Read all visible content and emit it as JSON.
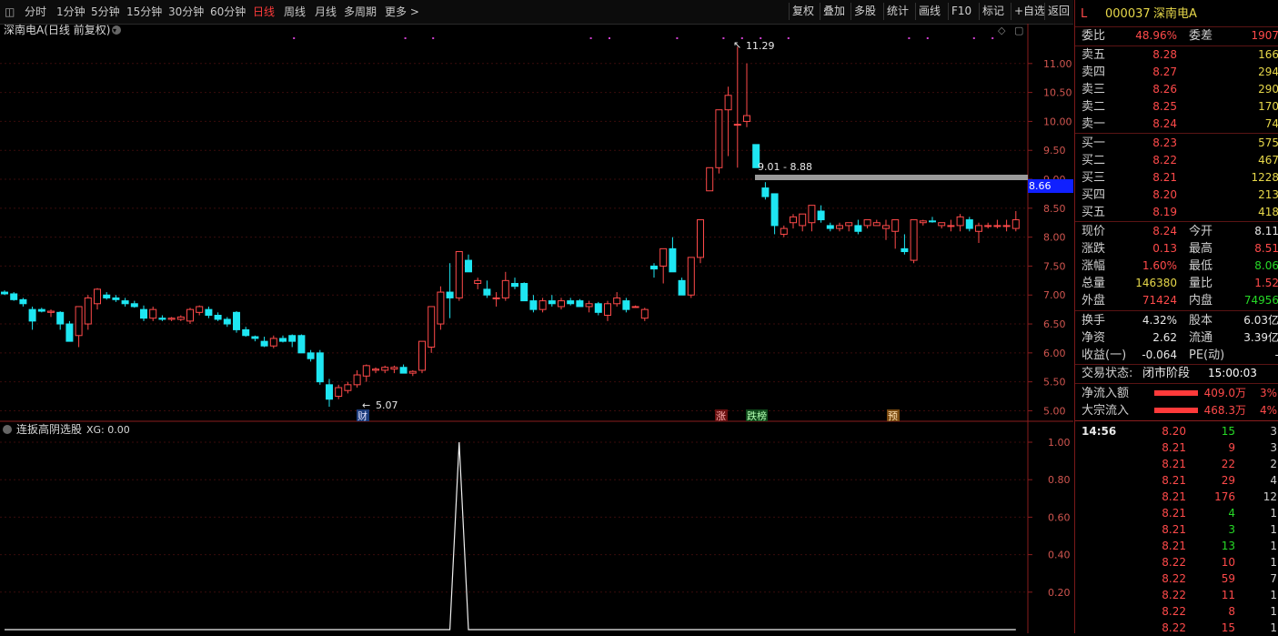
{
  "toolbar": {
    "periods": [
      "分时",
      "1分钟",
      "5分钟",
      "15分钟",
      "30分钟",
      "60分钟",
      "日线",
      "周线",
      "月线",
      "多周期",
      "更多 >"
    ],
    "active_period": "日线",
    "actions": [
      "复权",
      "叠加",
      "多股",
      "统计",
      "画线",
      "F10",
      "标记",
      "+自选",
      "返回"
    ]
  },
  "main_chart": {
    "title": "深南电A(日线 前复权)",
    "y_ticks": [
      "11.00",
      "10.50",
      "10.00",
      "9.50",
      "9.00",
      "8.50",
      "8.00",
      "7.50",
      "7.00",
      "6.50",
      "6.00",
      "5.50",
      "5.00"
    ],
    "high_label": "11.29",
    "low_label": "5.07",
    "range_label": "9.01 - 8.88",
    "current_price_tag": "8.66",
    "event_markers": [
      "财",
      "涨",
      "跌榜",
      "预"
    ]
  },
  "indicator": {
    "title": "连扳高阴选股",
    "value_label": "XG: 0.00",
    "y_ticks": [
      "1.00",
      "0.80",
      "0.60",
      "0.40",
      "0.20"
    ]
  },
  "chart_data": {
    "type": "candlestick",
    "ylim": [
      4.85,
      11.5
    ],
    "candles": [
      [
        7.05,
        7.08,
        7.0,
        7.02
      ],
      [
        7.02,
        7.05,
        6.9,
        6.92
      ],
      [
        6.92,
        6.95,
        6.8,
        6.85
      ],
      [
        6.75,
        6.8,
        6.4,
        6.55
      ],
      [
        6.75,
        6.78,
        6.7,
        6.72
      ],
      [
        6.7,
        6.75,
        6.62,
        6.72
      ],
      [
        6.7,
        6.72,
        6.4,
        6.5
      ],
      [
        6.5,
        6.55,
        6.2,
        6.2
      ],
      [
        6.3,
        6.8,
        6.1,
        6.8
      ],
      [
        6.5,
        7.0,
        6.4,
        6.95
      ],
      [
        6.85,
        7.12,
        6.75,
        7.1
      ],
      [
        7.0,
        7.05,
        6.92,
        6.95
      ],
      [
        6.95,
        7.0,
        6.88,
        6.92
      ],
      [
        6.9,
        6.95,
        6.8,
        6.85
      ],
      [
        6.85,
        6.9,
        6.78,
        6.8
      ],
      [
        6.75,
        6.82,
        6.55,
        6.6
      ],
      [
        6.6,
        6.8,
        6.55,
        6.75
      ],
      [
        6.6,
        6.65,
        6.55,
        6.58
      ],
      [
        6.58,
        6.62,
        6.55,
        6.6
      ],
      [
        6.58,
        6.65,
        6.55,
        6.62
      ],
      [
        6.55,
        6.78,
        6.5,
        6.75
      ],
      [
        6.7,
        6.82,
        6.65,
        6.8
      ],
      [
        6.75,
        6.8,
        6.6,
        6.65
      ],
      [
        6.65,
        6.7,
        6.55,
        6.58
      ],
      [
        6.58,
        6.62,
        6.45,
        6.5
      ],
      [
        6.7,
        6.72,
        6.35,
        6.4
      ],
      [
        6.4,
        6.45,
        6.28,
        6.3
      ],
      [
        6.28,
        6.3,
        6.2,
        6.25
      ],
      [
        6.2,
        6.28,
        6.1,
        6.12
      ],
      [
        6.12,
        6.3,
        6.08,
        6.25
      ],
      [
        6.25,
        6.3,
        6.18,
        6.2
      ],
      [
        6.3,
        6.32,
        6.1,
        6.2
      ],
      [
        6.3,
        6.32,
        6.0,
        6.0
      ],
      [
        6.0,
        6.05,
        5.85,
        5.9
      ],
      [
        6.0,
        6.05,
        5.45,
        5.5
      ],
      [
        5.45,
        5.55,
        5.07,
        5.2
      ],
      [
        5.25,
        5.45,
        5.2,
        5.4
      ],
      [
        5.35,
        5.5,
        5.3,
        5.45
      ],
      [
        5.45,
        5.7,
        5.4,
        5.62
      ],
      [
        5.6,
        5.8,
        5.5,
        5.78
      ],
      [
        5.7,
        5.75,
        5.65,
        5.72
      ],
      [
        5.7,
        5.78,
        5.65,
        5.75
      ],
      [
        5.72,
        5.78,
        5.65,
        5.75
      ],
      [
        5.75,
        5.8,
        5.65,
        5.65
      ],
      [
        5.65,
        5.7,
        5.6,
        5.68
      ],
      [
        5.7,
        6.2,
        5.65,
        6.2
      ],
      [
        6.1,
        6.8,
        6.0,
        6.8
      ],
      [
        6.5,
        7.15,
        6.4,
        7.05
      ],
      [
        7.05,
        7.55,
        6.6,
        6.95
      ],
      [
        6.95,
        7.75,
        6.9,
        7.75
      ],
      [
        7.6,
        7.7,
        7.4,
        7.4
      ],
      [
        7.2,
        7.3,
        7.1,
        7.25
      ],
      [
        7.1,
        7.25,
        6.95,
        7.0
      ],
      [
        6.95,
        7.05,
        6.8,
        6.95
      ],
      [
        6.95,
        7.4,
        6.9,
        7.25
      ],
      [
        7.2,
        7.3,
        7.1,
        7.15
      ],
      [
        7.2,
        7.22,
        6.9,
        6.9
      ],
      [
        6.9,
        7.0,
        6.7,
        6.75
      ],
      [
        6.75,
        6.95,
        6.7,
        6.9
      ],
      [
        6.9,
        7.0,
        6.8,
        6.85
      ],
      [
        6.8,
        6.95,
        6.75,
        6.9
      ],
      [
        6.9,
        6.95,
        6.82,
        6.85
      ],
      [
        6.9,
        6.93,
        6.8,
        6.8
      ],
      [
        6.8,
        6.9,
        6.7,
        6.85
      ],
      [
        6.85,
        6.88,
        6.65,
        6.7
      ],
      [
        6.65,
        6.9,
        6.55,
        6.85
      ],
      [
        6.85,
        7.05,
        6.8,
        6.95
      ],
      [
        6.9,
        6.95,
        6.7,
        6.75
      ],
      [
        6.8,
        6.82,
        6.78,
        6.8
      ],
      [
        6.6,
        6.78,
        6.55,
        6.75
      ],
      [
        7.5,
        7.55,
        7.3,
        7.45
      ],
      [
        7.5,
        7.7,
        7.2,
        7.8
      ],
      [
        7.8,
        8.0,
        7.4,
        7.4
      ],
      [
        7.25,
        7.3,
        7.0,
        7.0
      ],
      [
        7.0,
        7.65,
        6.95,
        7.65
      ],
      [
        7.65,
        8.2,
        7.55,
        8.3
      ],
      [
        8.8,
        9.1,
        8.8,
        9.2
      ],
      [
        9.2,
        10.2,
        9.1,
        10.2
      ],
      [
        10.2,
        10.6,
        9.4,
        10.45
      ],
      [
        9.95,
        11.29,
        9.2,
        9.95
      ],
      [
        10.0,
        11.0,
        9.9,
        10.1
      ],
      [
        9.6,
        9.6,
        9.2,
        9.2
      ],
      [
        8.85,
        8.95,
        8.65,
        8.7
      ],
      [
        8.75,
        8.75,
        8.05,
        8.2
      ],
      [
        8.05,
        8.2,
        8.0,
        8.15
      ],
      [
        8.25,
        8.4,
        8.15,
        8.35
      ],
      [
        8.2,
        8.4,
        8.1,
        8.4
      ],
      [
        8.25,
        8.55,
        8.1,
        8.55
      ],
      [
        8.45,
        8.55,
        8.25,
        8.3
      ],
      [
        8.2,
        8.25,
        8.1,
        8.15
      ],
      [
        8.15,
        8.25,
        8.1,
        8.2
      ],
      [
        8.2,
        8.25,
        8.1,
        8.25
      ],
      [
        8.2,
        8.3,
        8.05,
        8.1
      ],
      [
        8.2,
        8.3,
        8.15,
        8.3
      ],
      [
        8.2,
        8.3,
        8.2,
        8.25
      ],
      [
        8.15,
        8.3,
        7.95,
        8.2
      ],
      [
        8.1,
        8.3,
        7.8,
        8.3
      ],
      [
        7.8,
        8.05,
        7.7,
        7.75
      ],
      [
        7.6,
        8.3,
        7.55,
        8.3
      ],
      [
        8.25,
        8.3,
        8.2,
        8.28
      ],
      [
        8.28,
        8.35,
        8.25,
        8.27
      ],
      [
        8.2,
        8.25,
        8.15,
        8.25
      ],
      [
        8.2,
        8.3,
        8.1,
        8.2
      ],
      [
        8.2,
        8.4,
        8.1,
        8.35
      ],
      [
        8.3,
        8.35,
        8.1,
        8.15
      ],
      [
        8.1,
        8.25,
        7.9,
        8.2
      ],
      [
        8.2,
        8.25,
        8.15,
        8.2
      ],
      [
        8.2,
        8.3,
        8.15,
        8.2
      ],
      [
        8.2,
        8.3,
        8.1,
        8.2
      ],
      [
        8.15,
        8.45,
        8.1,
        8.3
      ]
    ],
    "indicator_series": {
      "name": "XG",
      "signal_index": 49,
      "values_default": 0,
      "signal_value": 1
    }
  },
  "panel": {
    "code": "000037",
    "name": "深南电A",
    "flag": "L",
    "weibi_label": "委比",
    "weibi": "48.96%",
    "weicha_label": "委差",
    "weicha": "1907",
    "sells": [
      {
        "label": "卖五",
        "price": "8.28",
        "vol": "166"
      },
      {
        "label": "卖四",
        "price": "8.27",
        "vol": "294"
      },
      {
        "label": "卖三",
        "price": "8.26",
        "vol": "290"
      },
      {
        "label": "卖二",
        "price": "8.25",
        "vol": "170"
      },
      {
        "label": "卖一",
        "price": "8.24",
        "vol": "74"
      }
    ],
    "buys": [
      {
        "label": "买一",
        "price": "8.23",
        "vol": "575"
      },
      {
        "label": "买二",
        "price": "8.22",
        "vol": "467"
      },
      {
        "label": "买三",
        "price": "8.21",
        "vol": "1228"
      },
      {
        "label": "买四",
        "price": "8.20",
        "vol": "213"
      },
      {
        "label": "买五",
        "price": "8.19",
        "vol": "418"
      }
    ],
    "stats": [
      {
        "l1": "现价",
        "v1": "8.24",
        "c1": "red",
        "l2": "今开",
        "v2": "8.11",
        "c2": "white"
      },
      {
        "l1": "涨跌",
        "v1": "0.13",
        "c1": "red",
        "l2": "最高",
        "v2": "8.51",
        "c2": "red"
      },
      {
        "l1": "涨幅",
        "v1": "1.60%",
        "c1": "red",
        "l2": "最低",
        "v2": "8.06",
        "c2": "green"
      },
      {
        "l1": "总量",
        "v1": "146380",
        "c1": "yellow",
        "l2": "量比",
        "v2": "1.52",
        "c2": "red"
      },
      {
        "l1": "外盘",
        "v1": "71424",
        "c1": "red",
        "l2": "内盘",
        "v2": "74956",
        "c2": "green"
      }
    ],
    "stats2": [
      {
        "l1": "换手",
        "v1": "4.32%",
        "l2": "股本",
        "v2": "6.03亿"
      },
      {
        "l1": "净资",
        "v1": "2.62",
        "l2": "流通",
        "v2": "3.39亿"
      },
      {
        "l1": "收益(一)",
        "v1": "-0.064",
        "l2": "PE(动)",
        "v2": "-"
      }
    ],
    "status_label": "交易状态:",
    "status_value": "闭市阶段",
    "status_time": "15:00:03",
    "flows": [
      {
        "label": "净流入额",
        "value": "409.0万",
        "pct": "3%"
      },
      {
        "label": "大宗流入",
        "value": "468.3万",
        "pct": "4%"
      }
    ],
    "ticks_time": "14:56",
    "ticks": [
      {
        "price": "8.20",
        "vol": "15",
        "vc": "green",
        "n": "3"
      },
      {
        "price": "8.21",
        "vol": "9",
        "vc": "red",
        "n": "3"
      },
      {
        "price": "8.21",
        "vol": "22",
        "vc": "red",
        "n": "2"
      },
      {
        "price": "8.21",
        "vol": "29",
        "vc": "red",
        "n": "4"
      },
      {
        "price": "8.21",
        "vol": "176",
        "vc": "red",
        "n": "12"
      },
      {
        "price": "8.21",
        "vol": "4",
        "vc": "green",
        "n": "1"
      },
      {
        "price": "8.21",
        "vol": "3",
        "vc": "green",
        "n": "1"
      },
      {
        "price": "8.21",
        "vol": "13",
        "vc": "green",
        "n": "1"
      },
      {
        "price": "8.22",
        "vol": "10",
        "vc": "red",
        "n": "1"
      },
      {
        "price": "8.22",
        "vol": "59",
        "vc": "red",
        "n": "7"
      },
      {
        "price": "8.22",
        "vol": "11",
        "vc": "red",
        "n": "1"
      },
      {
        "price": "8.22",
        "vol": "8",
        "vc": "red",
        "n": "1"
      },
      {
        "price": "8.22",
        "vol": "15",
        "vc": "red",
        "n": "1"
      }
    ],
    "colors": {
      "up": "#ff4a4a",
      "down": "#1ee6f2",
      "frame": "#7a1a1a"
    }
  }
}
